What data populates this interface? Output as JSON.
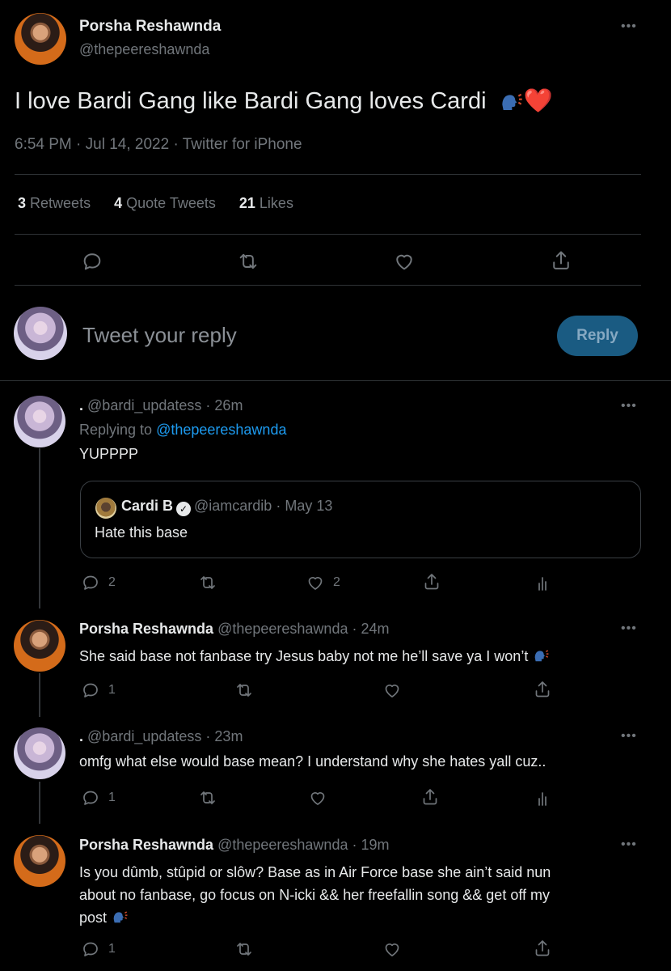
{
  "tweet": {
    "author_name": "Porsha Reshawnda",
    "author_handle": "@thepeereshawnda",
    "text": "I love Bardi Gang like Bardi Gang loves Cardi",
    "heart_emoji": "❤️",
    "meta": "6:54 PM · Jul 14, 2022 · Twitter for iPhone",
    "retweets_count": "3",
    "retweets_label": "Retweets",
    "quotes_count": "4",
    "quotes_label": "Quote Tweets",
    "likes_count": "21",
    "likes_label": "Likes"
  },
  "reply_box": {
    "placeholder": "Tweet your reply",
    "button": "Reply"
  },
  "replies": [
    {
      "name": ".",
      "handle": "@bardi_updatess",
      "time": "· 26m",
      "replying_label": "Replying to",
      "replying_to": "@thepeereshawnda",
      "text": "YUPPPP",
      "quote": {
        "name": "Cardi B",
        "verified": "✓",
        "handle": "@iamcardib",
        "time": "· May 13",
        "text": "Hate this base"
      },
      "reply_count": "2",
      "like_count": "2"
    },
    {
      "name": "Porsha Reshawnda",
      "handle": "@thepeereshawnda",
      "time": "· 24m",
      "text": "She said base not fanbase try Jesus baby not me he’ll save ya I won’t",
      "reply_count": "1"
    },
    {
      "name": ".",
      "handle": "@bardi_updatess",
      "time": "· 23m",
      "text": "omfg what else would base mean? I understand why she hates yall cuz..",
      "reply_count": "1"
    },
    {
      "name": "Porsha Reshawnda",
      "handle": "@thepeereshawnda",
      "time": "· 19m",
      "text_lines": [
        "Is you dûmb, stûpid or slôw? Base as in Air Force base she ain’t said nun",
        "about no fanbase, go focus on N-icki && her freefallin song && get off my",
        "post"
      ],
      "reply_count": "1"
    }
  ],
  "more_glyph": "•••",
  "colors": {
    "link": "#1d9bf0",
    "reply_button": "#1a5b82",
    "divider": "#2f3336"
  }
}
